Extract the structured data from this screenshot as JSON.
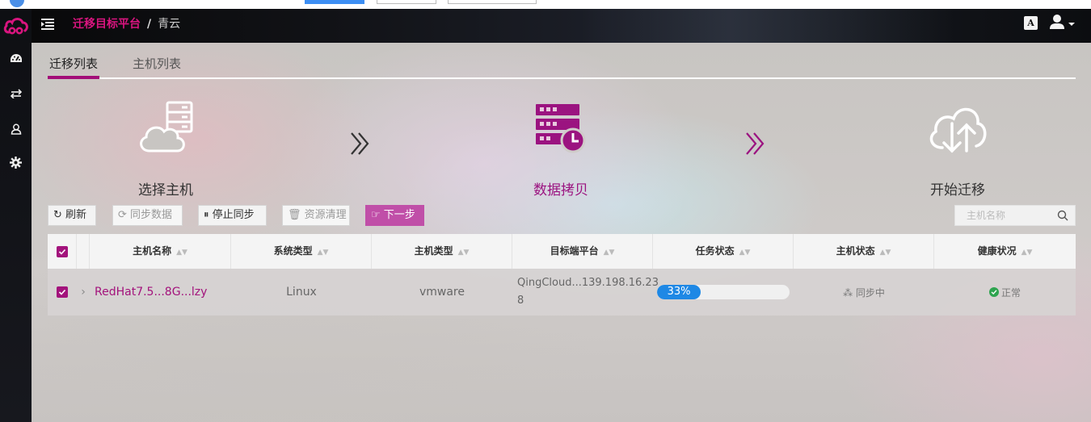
{
  "header": {
    "breadcrumb_primary": "迁移目标平台",
    "breadcrumb_sep": "/",
    "breadcrumb_secondary": "青云",
    "lang_label": "A"
  },
  "colors": {
    "brand": "#d9157f",
    "accent": "#a30d78",
    "progress": "#1e88e5",
    "healthy": "#2ea44f"
  },
  "sidebar": {
    "items": [
      {
        "icon": "dashboard-icon"
      },
      {
        "icon": "transfer-icon"
      },
      {
        "icon": "user-icon"
      },
      {
        "icon": "gear-icon"
      }
    ]
  },
  "tabs": [
    {
      "label": "迁移列表",
      "active": true
    },
    {
      "label": "主机列表",
      "active": false
    }
  ],
  "steps": [
    {
      "label": "选择主机",
      "icon": "cloud-server-icon",
      "active": false
    },
    {
      "label": "数据拷贝",
      "icon": "server-clock-icon",
      "active": true
    },
    {
      "label": "开始迁移",
      "icon": "cloud-transfer-icon",
      "active": false
    }
  ],
  "toolbar": {
    "refresh": "刷新",
    "sync_data": "同步数据",
    "stop_sync": "停止同步",
    "cleanup": "资源清理",
    "next_step": "下一步"
  },
  "search": {
    "placeholder": "主机名称"
  },
  "table": {
    "columns": [
      "主机名称",
      "系统类型",
      "主机类型",
      "目标端平台",
      "任务状态",
      "主机状态",
      "健康状况"
    ],
    "rows": [
      {
        "host_name": "RedHat7.5...8G...lzy",
        "os_type": "Linux",
        "host_type": "vmware",
        "target_platform": "QingCloud...139.198.16.23",
        "target_platform_wrap": "8",
        "task_progress": 33,
        "task_progress_label": "33%",
        "host_status": "同步中",
        "health": "正常"
      }
    ]
  }
}
